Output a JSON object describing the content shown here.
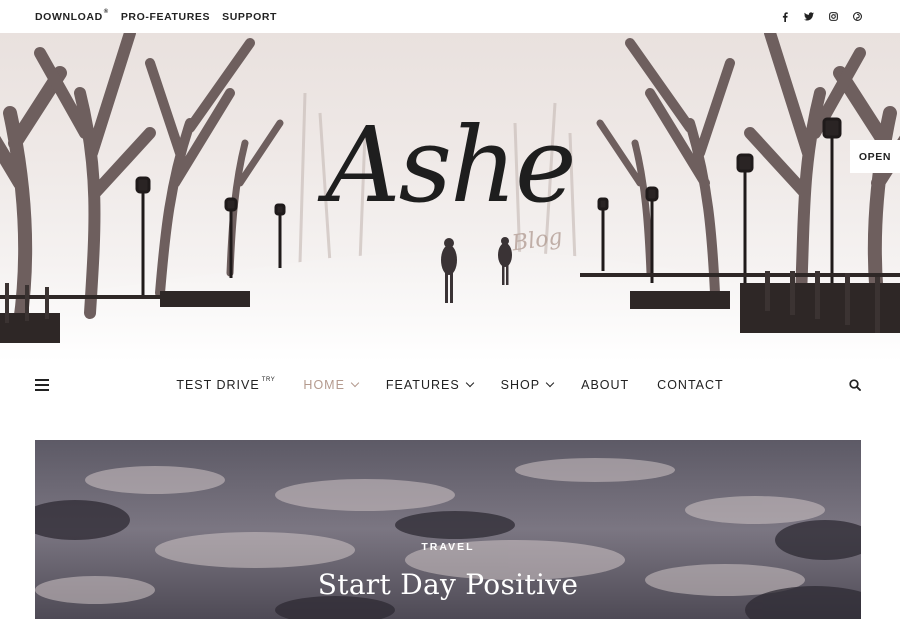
{
  "topbar": {
    "links": [
      {
        "label": "DOWNLOAD",
        "sup": "®"
      },
      {
        "label": "PRO-FEATURES",
        "sup": ""
      },
      {
        "label": "SUPPORT",
        "sup": ""
      }
    ],
    "social": [
      "facebook-icon",
      "twitter-icon",
      "instagram-icon",
      "pinterest-icon"
    ]
  },
  "header": {
    "logo": "Ashe",
    "tagline": "Blog",
    "open_label": "OPEN"
  },
  "nav": {
    "items": [
      {
        "label": "TEST DRIVE",
        "sup": "TRY",
        "dropdown": false,
        "active": false
      },
      {
        "label": "HOME",
        "sup": "",
        "dropdown": true,
        "active": true
      },
      {
        "label": "FEATURES",
        "sup": "",
        "dropdown": true,
        "active": false
      },
      {
        "label": "SHOP",
        "sup": "",
        "dropdown": true,
        "active": false
      },
      {
        "label": "ABOUT",
        "sup": "",
        "dropdown": false,
        "active": false
      },
      {
        "label": "CONTACT",
        "sup": "",
        "dropdown": false,
        "active": false
      }
    ],
    "active_color": "#b49a8e"
  },
  "feature": {
    "category": "TRAVEL",
    "title": "Start Day Positive"
  }
}
